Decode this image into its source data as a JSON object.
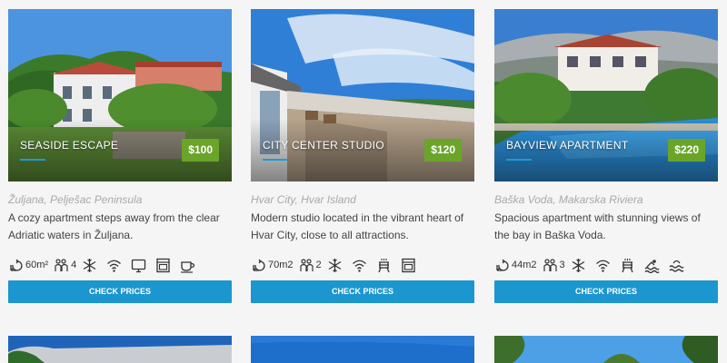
{
  "cards": [
    {
      "title": "SEASIDE ESCAPE",
      "price": "$100",
      "location": "Žuljana, Pelješac Peninsula",
      "description": "A cozy apartment steps away from the clear Adriatic waters in Žuljana.",
      "size": "60m²",
      "guests": "4",
      "amenity_icons": [
        "area-icon",
        "guests-icon",
        "air-conditioning-icon",
        "wifi-icon",
        "tv-icon",
        "oven-icon",
        "coffee-icon"
      ],
      "button": "CHECK PRICES"
    },
    {
      "title": "CITY CENTER STUDIO",
      "price": "$120",
      "location": "Hvar City, Hvar Island",
      "description": "Modern studio located in the vibrant heart of Hvar City, close to all attractions.",
      "size": "70m2",
      "guests": "2",
      "amenity_icons": [
        "area-icon",
        "guests-icon",
        "air-conditioning-icon",
        "wifi-icon",
        "grill-icon",
        "oven-icon"
      ],
      "button": "CHECK PRICES"
    },
    {
      "title": "BAYVIEW APARTMENT",
      "price": "$220",
      "location": "Baška Voda, Makarska Riviera",
      "description": "Spacious apartment with stunning views of the bay in Baška Voda.",
      "size": "44m2",
      "guests": "3",
      "amenity_icons": [
        "area-icon",
        "guests-icon",
        "air-conditioning-icon",
        "wifi-icon",
        "grill-icon",
        "pool-icon",
        "sea-view-icon"
      ],
      "button": "CHECK PRICES"
    }
  ],
  "colors": {
    "accent": "#1b96cf",
    "price_badge": "#6aa52a",
    "location_text": "#a8a8a8",
    "page_bg": "#f5f5f5"
  }
}
